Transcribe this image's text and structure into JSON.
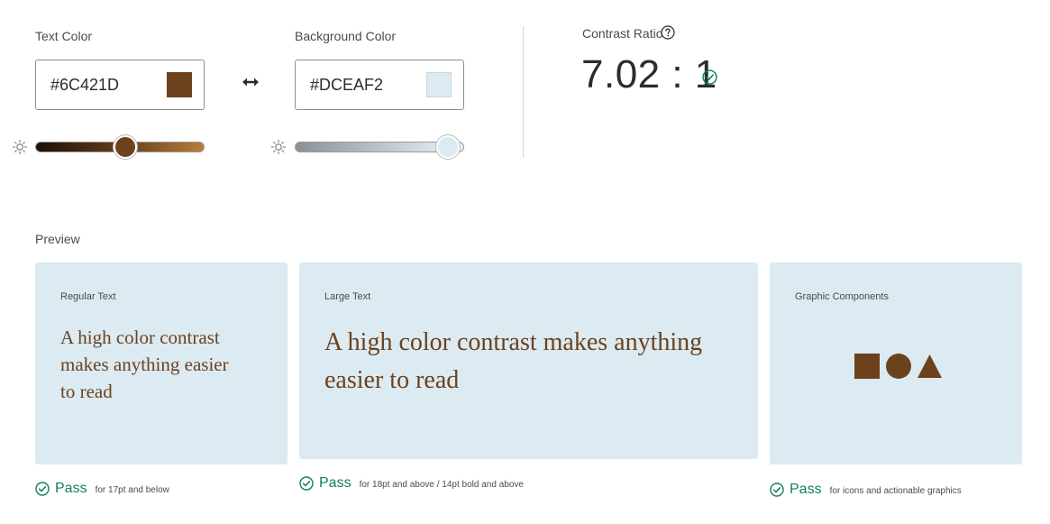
{
  "text_color": {
    "label": "Text Color",
    "value": "#6C421D",
    "swatch": "#6C421D",
    "brightness": 0.53,
    "icon": "brightness-icon"
  },
  "background_color": {
    "label": "Background Color",
    "value": "#DCEAF2",
    "swatch": "#DCEAF2",
    "brightness": 0.9,
    "icon": "brightness-icon"
  },
  "swap_icon": "swap-arrows-icon",
  "contrast": {
    "label": "Contrast Ratio",
    "value": "7.02 : 1",
    "help_icon": "help-icon",
    "status_icon": "checkmark-circle-icon"
  },
  "preview": {
    "label": "Preview",
    "cards": [
      {
        "title": "Regular Text",
        "sample": "A high color contrast makes anything easier to read",
        "result": "Pass",
        "note": "for 17pt and below"
      },
      {
        "title": "Large Text",
        "sample": "A high color contrast makes anything easier to read",
        "result": "Pass",
        "note": "for 18pt and above / 14pt bold and above"
      },
      {
        "title": "Graphic Components",
        "shapes": [
          "square-icon",
          "circle-icon",
          "triangle-icon"
        ],
        "result": "Pass",
        "note": "for icons and actionable graphics"
      }
    ]
  },
  "colors": {
    "pass_green": "#12805C",
    "card_bg": "#DCEAF2",
    "sample_text": "#6C421D"
  }
}
